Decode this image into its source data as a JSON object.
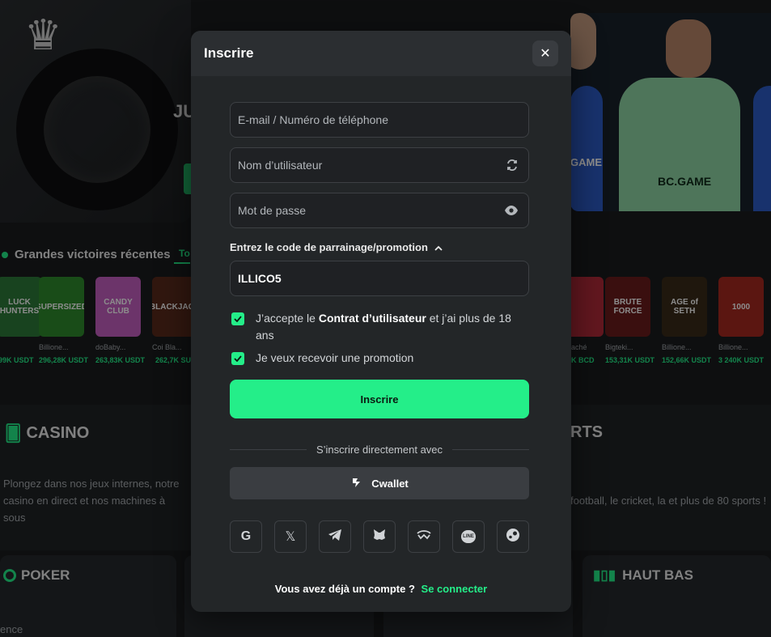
{
  "background": {
    "hero_text": "JU",
    "jersey_brand_main": "BC.GAME",
    "jersey_brand_side": "GAME",
    "recent_wins": {
      "title": "Grandes victoires récentes",
      "tab": "To",
      "cards": [
        {
          "label": "LUCK HUNTERS",
          "color": "#2d7a3a",
          "user": "",
          "amount": "99K USDT"
        },
        {
          "label": "SUPERSIZED",
          "color": "#2e8a2c",
          "user": "Billione...",
          "amount": "296,28K USDT"
        },
        {
          "label": "CANDY CLUB",
          "color": "#c55fc1",
          "user": "doBaby...",
          "amount": "263,83K USDT"
        },
        {
          "label": "BLACKJACK",
          "color": "#5a2b1c",
          "user": "Coi Bla...",
          "amount": "262,7K SU"
        },
        {
          "label": "",
          "color": "#b32a3a",
          "user": "aché",
          "amount": "K BCD"
        },
        {
          "label": "BRUTE FORCE",
          "color": "#6a1d1d",
          "user": "Bigteki...",
          "amount": "153,31K USDT"
        },
        {
          "label": "AGE of SETH",
          "color": "#3a2b18",
          "user": "Billione...",
          "amount": "152,66K USDT"
        },
        {
          "label": "1000",
          "color": "#a6281f",
          "user": "Billione...",
          "amount": "3 240K USDT"
        }
      ]
    },
    "casino": {
      "title": "CASINO",
      "desc": "Plongez dans nos jeux internes, notre casino en direct et nos machines à sous"
    },
    "sports": {
      "title": "RTS",
      "desc": "football, le cricket, la et plus de 80 sports !"
    },
    "poker_title": "POKER",
    "hautbas_title": "HAUT BAS",
    "bottom_left_text": "ence"
  },
  "modal": {
    "title": "Inscrire",
    "fields": {
      "email_placeholder": "E-mail / Numéro de téléphone",
      "username_placeholder": "Nom d’utilisateur",
      "password_placeholder": "Mot de passe"
    },
    "promo": {
      "label": "Entrez le code de parrainage/promotion",
      "value": "ILLICO5"
    },
    "terms": {
      "prefix": "J’accepte le",
      "link": "Contrat d’utilisateur",
      "suffix": "et j’ai plus de 18 ans"
    },
    "promo_opt_in": "Je veux recevoir une promotion",
    "submit_label": "Inscrire",
    "divider_text": "S’inscrire directement avec",
    "cwallet_label": "Cwallet",
    "socials": [
      "google-icon",
      "x-icon",
      "telegram-icon",
      "metamask-icon",
      "walletconnect-icon",
      "line-icon",
      "steam-icon"
    ],
    "login_prompt": "Vous avez déjà un compte ?",
    "login_link": "Se connecter"
  },
  "colors": {
    "accent": "#24ee89",
    "modal_bg": "#232628",
    "modal_header": "#2b2e31"
  }
}
